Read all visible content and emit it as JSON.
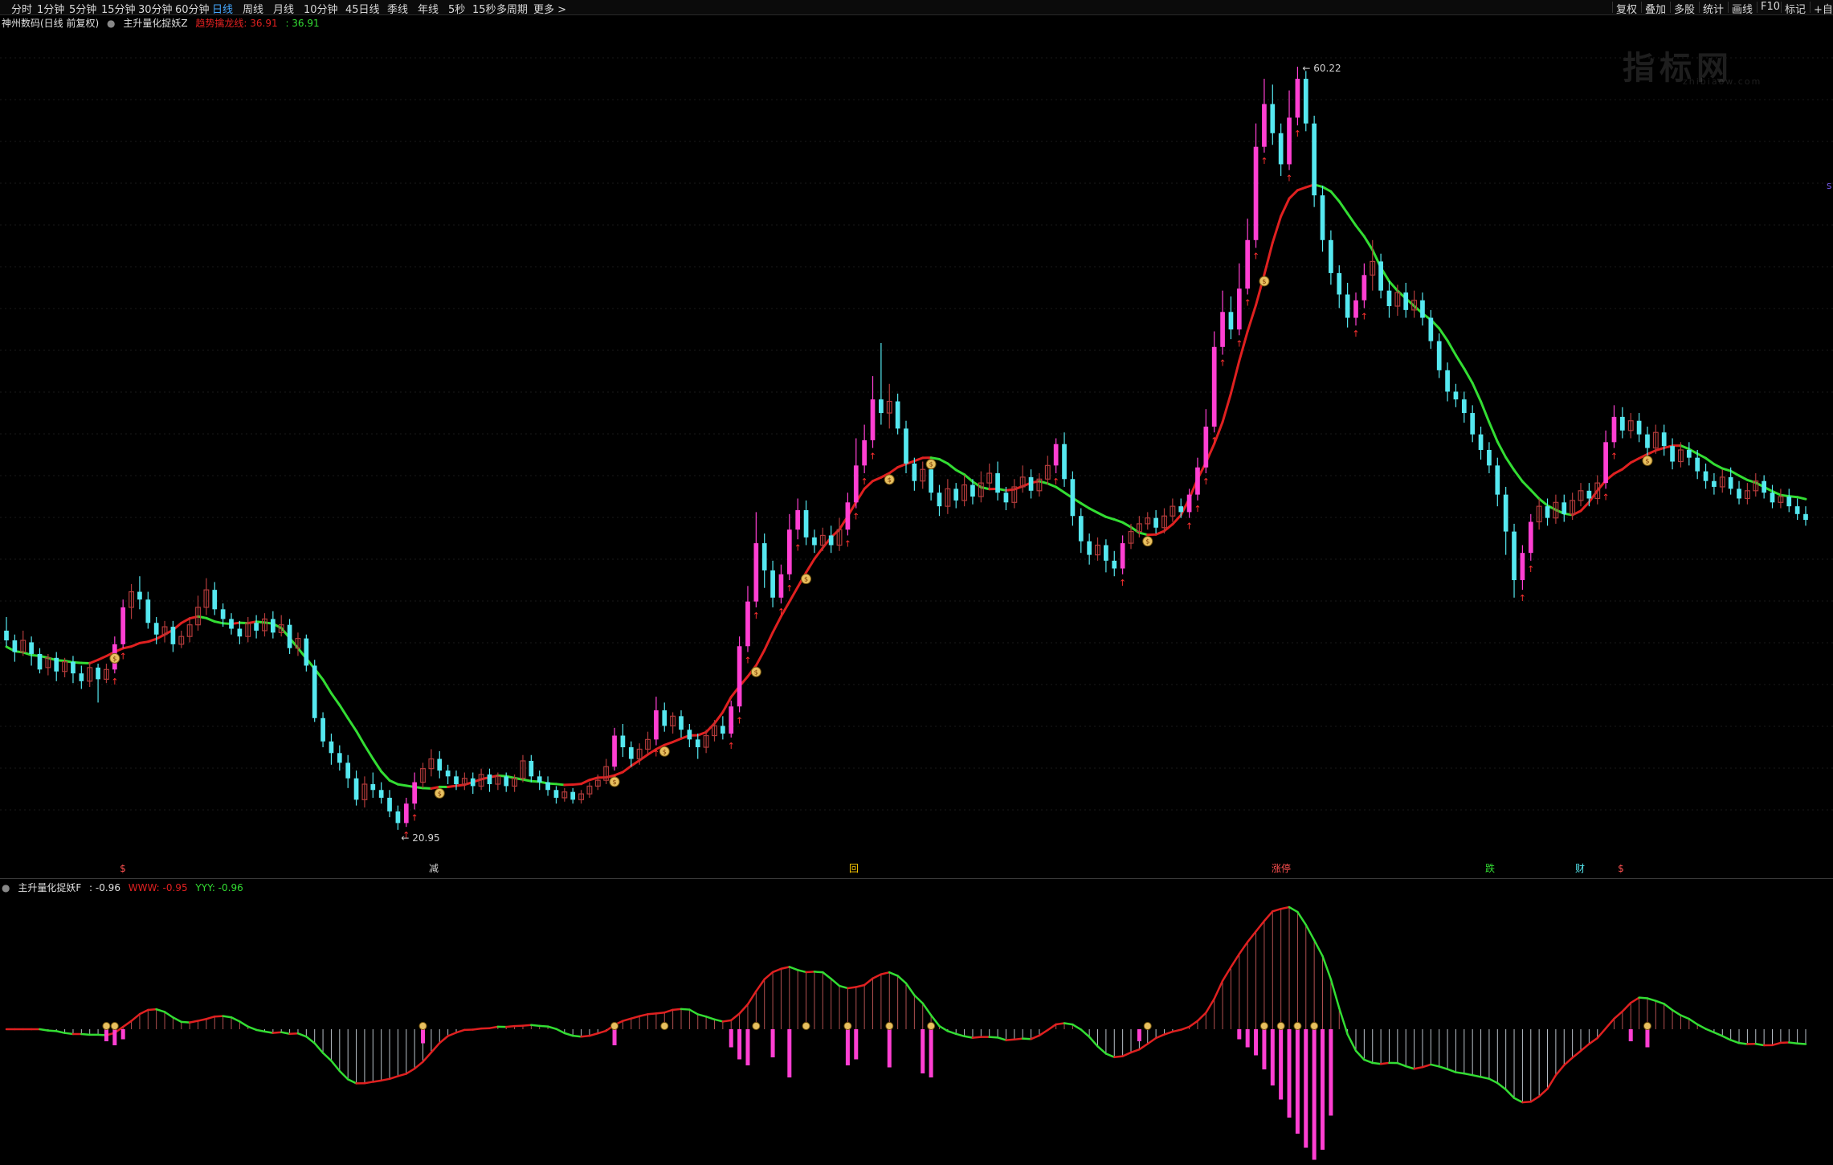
{
  "toolbar": {
    "periods": [
      "分时",
      "1分钟",
      "5分钟",
      "15分钟",
      "30分钟",
      "60分钟",
      "日线",
      "周线",
      "月线",
      "10分钟",
      "45日线",
      "季线",
      "年线",
      "5秒",
      "15秒",
      "多周期",
      "更多 >"
    ],
    "active": "日线",
    "right_tools": [
      "复权",
      "叠加",
      "多股",
      "统计",
      "画线",
      "F10",
      "标记",
      "+自"
    ]
  },
  "main_legend": {
    "stock": "神州数码(日线 前复权)",
    "indicator": "主升量化捉妖Z",
    "trend_label": "趋势擒龙线: 36.91",
    "trend_value2": ": 36.91"
  },
  "sub_legend": {
    "indicator": "主升量化捉妖F",
    "val1": ": -0.96",
    "www": "WWW: -0.95",
    "yyy": "YYY: -0.96"
  },
  "annotations": {
    "high_label": "60.22",
    "low_label": "← 20.95",
    "bottom_marks": [
      "$",
      "减",
      "回",
      "涨停",
      "跌",
      "财",
      "$"
    ]
  },
  "watermark": {
    "text": "指标网",
    "sub": "zhibiaow.com"
  },
  "colors": {
    "bg": "#000000",
    "up": "#ff3fd2",
    "down": "#55e8f0",
    "neutral_up": "#b03a3a",
    "line_up": "#e02020",
    "line_down": "#33dd33",
    "signal": "#ffd700"
  },
  "chart_data": [
    {
      "type": "candlestick",
      "title": "神州数码(日线 前复权)",
      "ylim": [
        19,
        62
      ],
      "annotations": [
        "60.22",
        "20.95"
      ],
      "candles": [
        [
          31.2,
          30.7,
          31.9,
          30.4
        ],
        [
          30.7,
          30.1,
          31.0,
          29.6
        ],
        [
          30.1,
          30.7,
          31.2,
          29.9
        ],
        [
          30.6,
          30.0,
          30.9,
          29.4
        ],
        [
          30.0,
          29.2,
          30.3,
          29.0
        ],
        [
          29.3,
          29.8,
          30.0,
          28.9
        ],
        [
          29.8,
          29.1,
          30.1,
          28.6
        ],
        [
          29.1,
          29.6,
          29.8,
          28.8
        ],
        [
          29.6,
          29.0,
          29.9,
          28.5
        ],
        [
          29.0,
          28.6,
          29.4,
          28.2
        ],
        [
          28.6,
          29.3,
          29.6,
          28.3
        ],
        [
          29.3,
          28.7,
          29.5,
          27.5
        ],
        [
          28.7,
          29.2,
          29.5,
          28.5
        ],
        [
          29.2,
          30.5,
          30.9,
          29.0
        ],
        [
          30.5,
          32.4,
          32.8,
          30.3
        ],
        [
          32.4,
          33.2,
          33.6,
          31.8
        ],
        [
          33.2,
          32.8,
          34.0,
          32.3
        ],
        [
          32.8,
          31.6,
          33.2,
          31.3
        ],
        [
          31.6,
          31.0,
          31.9,
          30.5
        ],
        [
          31.0,
          31.4,
          31.7,
          30.6
        ],
        [
          31.4,
          30.5,
          31.7,
          30.1
        ],
        [
          30.5,
          30.9,
          31.2,
          30.3
        ],
        [
          30.9,
          31.5,
          31.9,
          30.6
        ],
        [
          31.5,
          32.4,
          33.0,
          31.2
        ],
        [
          32.4,
          33.3,
          33.9,
          32.0
        ],
        [
          33.3,
          32.3,
          33.7,
          32.0
        ],
        [
          32.3,
          31.8,
          32.6,
          31.4
        ],
        [
          31.8,
          31.3,
          32.1,
          31.0
        ],
        [
          31.3,
          30.9,
          31.7,
          30.5
        ],
        [
          30.9,
          31.6,
          31.9,
          30.6
        ],
        [
          31.6,
          31.2,
          32.0,
          30.8
        ],
        [
          31.2,
          31.8,
          32.1,
          30.9
        ],
        [
          31.8,
          31.1,
          32.2,
          30.8
        ],
        [
          31.1,
          31.5,
          32.0,
          30.9
        ],
        [
          31.5,
          30.3,
          31.8,
          30.0
        ],
        [
          30.3,
          30.8,
          31.1,
          29.9
        ],
        [
          30.8,
          29.4,
          31.0,
          29.1
        ],
        [
          29.4,
          26.7,
          29.7,
          26.5
        ],
        [
          26.7,
          25.5,
          27.0,
          25.2
        ],
        [
          25.5,
          24.9,
          25.9,
          24.3
        ],
        [
          24.9,
          24.4,
          25.3,
          24.0
        ],
        [
          24.4,
          23.6,
          24.8,
          23.1
        ],
        [
          23.6,
          22.5,
          24.0,
          22.2
        ],
        [
          22.5,
          23.3,
          23.7,
          22.1
        ],
        [
          23.3,
          23.0,
          23.9,
          22.6
        ],
        [
          23.0,
          22.6,
          23.4,
          22.3
        ],
        [
          22.6,
          21.9,
          23.0,
          21.6
        ],
        [
          21.9,
          21.3,
          22.2,
          20.95
        ],
        [
          21.3,
          22.3,
          22.6,
          21.1
        ],
        [
          22.3,
          23.4,
          23.9,
          22.0
        ],
        [
          23.4,
          24.1,
          24.4,
          23.1
        ],
        [
          24.1,
          24.6,
          25.1,
          23.7
        ],
        [
          24.6,
          24.0,
          25.0,
          23.6
        ],
        [
          24.0,
          23.7,
          24.3,
          23.3
        ],
        [
          23.7,
          23.3,
          24.0,
          23.0
        ],
        [
          23.3,
          23.6,
          23.9,
          23.0
        ],
        [
          23.6,
          23.2,
          23.9,
          22.8
        ],
        [
          23.2,
          23.8,
          24.1,
          23.0
        ],
        [
          23.8,
          23.3,
          24.1,
          22.9
        ],
        [
          23.3,
          23.7,
          23.9,
          23.0
        ],
        [
          23.7,
          23.2,
          23.9,
          22.9
        ],
        [
          23.2,
          23.6,
          23.8,
          22.9
        ],
        [
          23.6,
          24.5,
          24.8,
          23.4
        ],
        [
          24.5,
          23.7,
          24.8,
          23.4
        ],
        [
          23.7,
          23.4,
          24.0,
          23.0
        ],
        [
          23.4,
          23.0,
          23.7,
          22.7
        ],
        [
          23.0,
          22.6,
          23.2,
          22.3
        ],
        [
          22.6,
          22.9,
          23.1,
          22.4
        ],
        [
          22.9,
          22.5,
          23.1,
          22.3
        ],
        [
          22.5,
          22.8,
          23.0,
          22.3
        ],
        [
          22.8,
          23.2,
          23.4,
          22.6
        ],
        [
          23.2,
          23.5,
          23.8,
          23.0
        ],
        [
          23.5,
          24.2,
          24.6,
          23.3
        ],
        [
          24.2,
          25.8,
          26.2,
          24.0
        ],
        [
          25.8,
          25.2,
          26.4,
          24.7
        ],
        [
          25.2,
          24.6,
          25.5,
          24.2
        ],
        [
          24.6,
          25.1,
          25.4,
          24.3
        ],
        [
          25.1,
          25.6,
          26.0,
          24.8
        ],
        [
          25.6,
          27.1,
          27.8,
          25.3
        ],
        [
          27.1,
          26.3,
          27.5,
          26.0
        ],
        [
          26.3,
          26.8,
          27.0,
          25.9
        ],
        [
          26.8,
          26.1,
          27.1,
          25.7
        ],
        [
          26.1,
          25.6,
          26.4,
          25.2
        ],
        [
          25.6,
          25.2,
          25.9,
          24.6
        ],
        [
          25.2,
          25.8,
          26.1,
          24.9
        ],
        [
          25.8,
          26.3,
          26.6,
          25.5
        ],
        [
          26.3,
          25.9,
          26.8,
          25.6
        ],
        [
          25.9,
          27.3,
          27.6,
          25.7
        ],
        [
          27.3,
          30.4,
          30.9,
          27.0
        ],
        [
          30.4,
          32.7,
          33.5,
          30.1
        ],
        [
          32.7,
          35.7,
          37.3,
          32.4
        ],
        [
          35.7,
          34.3,
          36.2,
          33.4
        ],
        [
          34.3,
          32.9,
          34.8,
          32.4
        ],
        [
          32.9,
          34.1,
          34.6,
          32.6
        ],
        [
          34.1,
          36.4,
          37.2,
          33.8
        ],
        [
          36.4,
          37.4,
          38.0,
          35.9
        ],
        [
          37.4,
          36.0,
          37.9,
          35.6
        ],
        [
          36.0,
          35.6,
          36.4,
          35.2
        ],
        [
          35.6,
          36.1,
          36.5,
          35.3
        ],
        [
          36.1,
          35.6,
          36.6,
          35.2
        ],
        [
          35.6,
          36.4,
          37.0,
          35.3
        ],
        [
          36.4,
          37.8,
          38.3,
          36.1
        ],
        [
          37.8,
          39.7,
          41.1,
          37.5
        ],
        [
          39.7,
          41.0,
          41.8,
          39.3
        ],
        [
          41.0,
          43.1,
          44.3,
          40.6
        ],
        [
          43.1,
          42.4,
          46.0,
          41.8
        ],
        [
          42.4,
          43.0,
          43.9,
          41.6
        ],
        [
          43.0,
          41.6,
          43.4,
          41.3
        ],
        [
          41.6,
          39.8,
          42.0,
          39.3
        ],
        [
          39.8,
          38.9,
          40.1,
          38.4
        ],
        [
          38.9,
          39.5,
          39.9,
          38.5
        ],
        [
          39.5,
          38.3,
          39.8,
          37.9
        ],
        [
          38.3,
          37.6,
          38.7,
          37.1
        ],
        [
          37.6,
          38.5,
          39.0,
          37.2
        ],
        [
          38.5,
          37.9,
          38.8,
          37.5
        ],
        [
          37.9,
          38.7,
          39.2,
          37.6
        ],
        [
          38.7,
          38.1,
          39.0,
          37.7
        ],
        [
          38.1,
          38.8,
          39.4,
          37.8
        ],
        [
          38.8,
          39.3,
          39.8,
          38.5
        ],
        [
          39.3,
          38.3,
          39.9,
          37.9
        ],
        [
          38.3,
          37.8,
          38.6,
          37.4
        ],
        [
          37.8,
          38.6,
          39.0,
          37.5
        ],
        [
          38.6,
          39.1,
          39.7,
          38.3
        ],
        [
          39.1,
          38.4,
          39.5,
          38.0
        ],
        [
          38.4,
          39.0,
          39.3,
          38.1
        ],
        [
          39.0,
          39.7,
          40.2,
          38.7
        ],
        [
          39.7,
          40.8,
          41.1,
          39.3
        ],
        [
          40.8,
          39.0,
          41.4,
          38.6
        ],
        [
          39.0,
          37.1,
          39.4,
          36.6
        ],
        [
          37.1,
          35.8,
          37.5,
          35.2
        ],
        [
          35.8,
          35.1,
          36.2,
          34.6
        ],
        [
          35.1,
          35.6,
          36.0,
          34.8
        ],
        [
          35.6,
          34.8,
          35.9,
          34.2
        ],
        [
          34.8,
          34.4,
          35.3,
          34.0
        ],
        [
          34.4,
          35.7,
          36.1,
          34.1
        ],
        [
          35.7,
          36.3,
          36.7,
          35.4
        ],
        [
          36.3,
          36.7,
          37.1,
          36.0
        ],
        [
          36.7,
          37.0,
          37.3,
          36.4
        ],
        [
          37.0,
          36.5,
          37.4,
          36.2
        ],
        [
          36.5,
          37.1,
          37.5,
          36.2
        ],
        [
          37.1,
          37.6,
          38.0,
          36.8
        ],
        [
          37.6,
          37.3,
          38.0,
          37.0
        ],
        [
          37.3,
          38.2,
          38.5,
          37.0
        ],
        [
          38.2,
          39.6,
          40.1,
          37.9
        ],
        [
          39.6,
          41.7,
          42.6,
          39.3
        ],
        [
          41.7,
          45.8,
          46.6,
          41.4
        ],
        [
          45.8,
          47.6,
          48.7,
          45.4
        ],
        [
          47.6,
          46.7,
          48.4,
          46.2
        ],
        [
          46.7,
          48.8,
          50.1,
          46.4
        ],
        [
          48.8,
          51.3,
          52.4,
          48.5
        ],
        [
          51.3,
          56.1,
          57.3,
          50.9
        ],
        [
          56.1,
          58.3,
          59.6,
          55.8
        ],
        [
          58.3,
          56.8,
          59.3,
          56.2
        ],
        [
          56.8,
          55.2,
          57.3,
          54.6
        ],
        [
          55.2,
          57.6,
          59.0,
          54.9
        ],
        [
          57.6,
          59.6,
          60.22,
          57.2
        ],
        [
          59.6,
          57.3,
          60.0,
          56.9
        ],
        [
          57.3,
          53.6,
          57.7,
          53.0
        ],
        [
          53.6,
          51.3,
          54.1,
          50.7
        ],
        [
          51.3,
          49.6,
          51.8,
          49.0
        ],
        [
          49.6,
          48.5,
          50.0,
          47.8
        ],
        [
          48.5,
          47.3,
          49.1,
          46.8
        ],
        [
          47.3,
          48.2,
          48.6,
          46.9
        ],
        [
          48.2,
          49.5,
          50.1,
          47.8
        ],
        [
          49.5,
          50.2,
          51.3,
          48.7
        ],
        [
          50.2,
          48.7,
          50.6,
          48.3
        ],
        [
          48.7,
          47.9,
          49.2,
          47.3
        ],
        [
          47.9,
          48.6,
          49.0,
          47.4
        ],
        [
          48.6,
          47.7,
          49.1,
          47.3
        ],
        [
          47.7,
          48.2,
          48.7,
          47.3
        ],
        [
          48.2,
          47.3,
          48.6,
          46.9
        ],
        [
          47.3,
          46.1,
          47.7,
          45.7
        ],
        [
          46.1,
          44.6,
          46.5,
          44.2
        ],
        [
          44.6,
          43.5,
          45.0,
          43.0
        ],
        [
          43.5,
          43.1,
          43.9,
          42.7
        ],
        [
          43.1,
          42.4,
          43.5,
          41.9
        ],
        [
          42.4,
          41.3,
          42.8,
          40.9
        ],
        [
          41.3,
          40.5,
          41.7,
          40.0
        ],
        [
          40.5,
          39.7,
          40.9,
          39.3
        ],
        [
          39.7,
          38.2,
          40.1,
          37.6
        ],
        [
          38.2,
          36.3,
          38.6,
          35.1
        ],
        [
          36.3,
          33.8,
          36.7,
          32.9
        ],
        [
          33.8,
          35.2,
          35.6,
          33.3
        ],
        [
          35.2,
          36.8,
          37.2,
          34.8
        ],
        [
          36.8,
          37.6,
          38.0,
          36.4
        ],
        [
          37.6,
          37.0,
          38.0,
          36.6
        ],
        [
          37.0,
          37.8,
          38.2,
          36.7
        ],
        [
          37.8,
          37.2,
          38.2,
          36.8
        ],
        [
          37.2,
          37.9,
          38.3,
          36.9
        ],
        [
          37.9,
          38.4,
          38.8,
          37.6
        ],
        [
          38.4,
          38.0,
          38.8,
          37.6
        ],
        [
          38.0,
          38.8,
          39.2,
          37.7
        ],
        [
          38.8,
          40.9,
          41.5,
          38.5
        ],
        [
          40.9,
          42.2,
          42.8,
          40.6
        ],
        [
          42.2,
          41.5,
          42.7,
          41.1
        ],
        [
          41.5,
          42.0,
          42.4,
          41.1
        ],
        [
          42.0,
          41.3,
          42.4,
          40.9
        ],
        [
          41.3,
          40.6,
          41.7,
          40.2
        ],
        [
          40.6,
          41.4,
          41.8,
          40.3
        ],
        [
          41.4,
          40.7,
          41.8,
          40.2
        ],
        [
          40.7,
          39.9,
          41.1,
          39.5
        ],
        [
          39.9,
          40.5,
          40.9,
          39.6
        ],
        [
          40.5,
          40.1,
          40.9,
          39.7
        ],
        [
          40.1,
          39.4,
          40.5,
          39.0
        ],
        [
          39.4,
          38.9,
          39.8,
          38.5
        ],
        [
          38.9,
          38.6,
          39.3,
          38.2
        ],
        [
          38.6,
          39.1,
          39.5,
          38.3
        ],
        [
          39.1,
          38.5,
          39.6,
          38.2
        ],
        [
          38.5,
          38.0,
          38.9,
          37.7
        ],
        [
          38.0,
          38.4,
          38.8,
          37.7
        ],
        [
          38.4,
          38.9,
          39.3,
          38.1
        ],
        [
          38.9,
          38.3,
          39.2,
          38.0
        ],
        [
          38.3,
          37.8,
          38.7,
          37.5
        ],
        [
          37.8,
          38.1,
          38.5,
          37.5
        ],
        [
          38.1,
          37.6,
          38.5,
          37.3
        ],
        [
          37.6,
          37.2,
          38.0,
          36.9
        ],
        [
          37.2,
          36.9,
          37.6,
          36.6
        ]
      ],
      "trend_line": {
        "name": "趋势擒龙线",
        "last": 36.91
      }
    },
    {
      "type": "line",
      "title": "主升量化捉妖F",
      "series": [
        {
          "name": "WWW",
          "last": -0.95
        },
        {
          "name": "YYY",
          "last": -0.96
        }
      ]
    }
  ]
}
